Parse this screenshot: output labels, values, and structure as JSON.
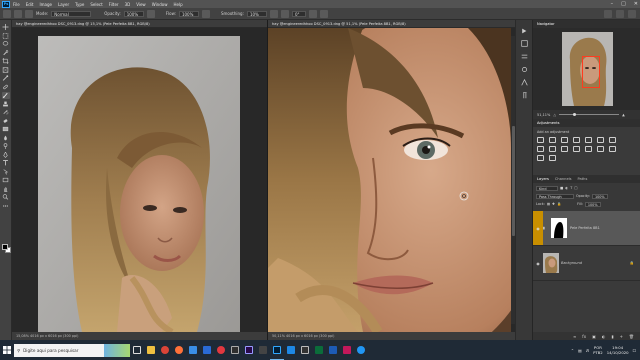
{
  "menu": [
    "File",
    "Edit",
    "Image",
    "Layer",
    "Type",
    "Select",
    "Filter",
    "3D",
    "View",
    "Window",
    "Help"
  ],
  "app_logo": "Ps",
  "options": {
    "mode_label": "Mode:",
    "mode_value": "Normal",
    "opacity_label": "Opacity:",
    "opacity_value": "100%",
    "flow_label": "Flow:",
    "flow_value": "100%",
    "smoothing_label": "Smoothing:",
    "smoothing_value": "10%",
    "angle_value": "0°"
  },
  "doc_left": {
    "tab": "hay @engineeredhhoo DSC_0913.dng @ 15,1% (Pele Perfeita 8B1, RGB/8)",
    "status": "15,08%   4016 px x 6016 px (300 ppi)"
  },
  "doc_right": {
    "tab": "hay @engineeredhhoo DSC_0913.dng @ 51,1% (Pele Perfeita 8B1, RGB/8)",
    "status": "50,11%   4016 px x 6016 px (300 ppi)"
  },
  "navigator": {
    "title": "Navigator",
    "zoom": "51,11%"
  },
  "adjustments": {
    "title": "Adjustments",
    "subtitle": "Add an adjustment"
  },
  "layers": {
    "tabs": [
      "Layers",
      "Channels",
      "Paths"
    ],
    "kind_label": "Kind",
    "blend_mode": "Pass Through",
    "opacity_label": "Opacity:",
    "opacity_value": "100%",
    "lock_label": "Lock:",
    "fill_label": "Fill:",
    "fill_value": "100%",
    "items": [
      {
        "name": "Pele Perfeita 8B1",
        "selected": true
      },
      {
        "name": "Background",
        "selected": false
      }
    ]
  },
  "taskbar": {
    "search_placeholder": "Digite aqui para pesquisar",
    "lang_top": "POR",
    "lang_bottom": "PTB2",
    "time": "19:04",
    "date": "14/10/2020"
  },
  "colors": {
    "accent": "#31a8ff",
    "layer_tag": "#c98f00",
    "nav_frame": "#ff3b1f"
  }
}
